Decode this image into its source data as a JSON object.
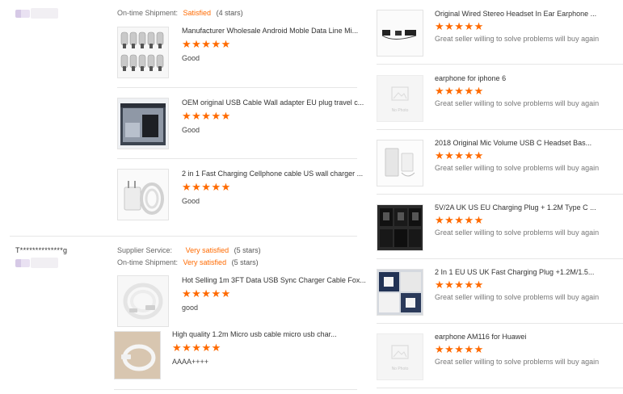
{
  "colors": {
    "accent": "#ff6a00",
    "separator": "#e6e6e6"
  },
  "left": {
    "review1": {
      "shipment_label": "On-time Shipment:",
      "shipment_value": "Satisfied",
      "shipment_stars": "(4 stars)",
      "items": [
        {
          "title": "Manufacturer Wholesale Android Moble Data Line Mi...",
          "stars": "★★★★★",
          "comment": "Good"
        },
        {
          "title": "OEM original USB Cable Wall adapter EU plug travel c...",
          "stars": "★★★★★",
          "comment": "Good"
        },
        {
          "title": "2 in 1 Fast Charging Cellphone cable US wall charger ...",
          "stars": "★★★★★",
          "comment": "Good"
        }
      ]
    },
    "review2": {
      "username": "T**************g",
      "service_label": "Supplier Service:",
      "service_value": "Very satisfied",
      "service_stars": "(5 stars)",
      "shipment_label": "On-time Shipment:",
      "shipment_value": "Very satisfied",
      "shipment_stars": "(5 stars)",
      "items": [
        {
          "title": "Hot Selling 1m 3FT Data USB Sync Charger Cable Fox...",
          "stars": "★★★★★",
          "comment": "good"
        },
        {
          "title": "High quality 1.2m Micro usb cable micro usb char...",
          "stars": "★★★★★",
          "comment": "AAAA++++"
        }
      ]
    }
  },
  "right": {
    "items": [
      {
        "title": "Original Wired Stereo Headset In Ear Earphone ...",
        "stars": "★★★★★",
        "comment": "Great seller willing to solve problems will buy again",
        "thumb": "earphones-photo"
      },
      {
        "title": "earphone for iphone 6",
        "stars": "★★★★★",
        "comment": "Great seller willing to solve problems will buy again",
        "thumb": "no-photo",
        "nophoto_text": "No Photo"
      },
      {
        "title": "2018 Original Mic Volume USB C Headset Bas...",
        "stars": "★★★★★",
        "comment": "Great seller willing to solve problems will buy again",
        "thumb": "headset-box-photo"
      },
      {
        "title": "5V/2A UK US EU Charging Plug + 1.2M Type C ...",
        "stars": "★★★★★",
        "comment": "Great seller willing to solve problems will buy again",
        "thumb": "chargers-photo"
      },
      {
        "title": "2 In 1 EU US UK Fast Charging Plug +1.2M/1.5...",
        "stars": "★★★★★",
        "comment": "Great seller willing to solve problems will buy again",
        "thumb": "charger-kits-photo"
      },
      {
        "title": "earphone AM116 for Huawei",
        "stars": "★★★★★",
        "comment": "Great seller willing to solve problems will buy again",
        "thumb": "no-photo",
        "nophoto_text": "No Photo"
      }
    ]
  }
}
